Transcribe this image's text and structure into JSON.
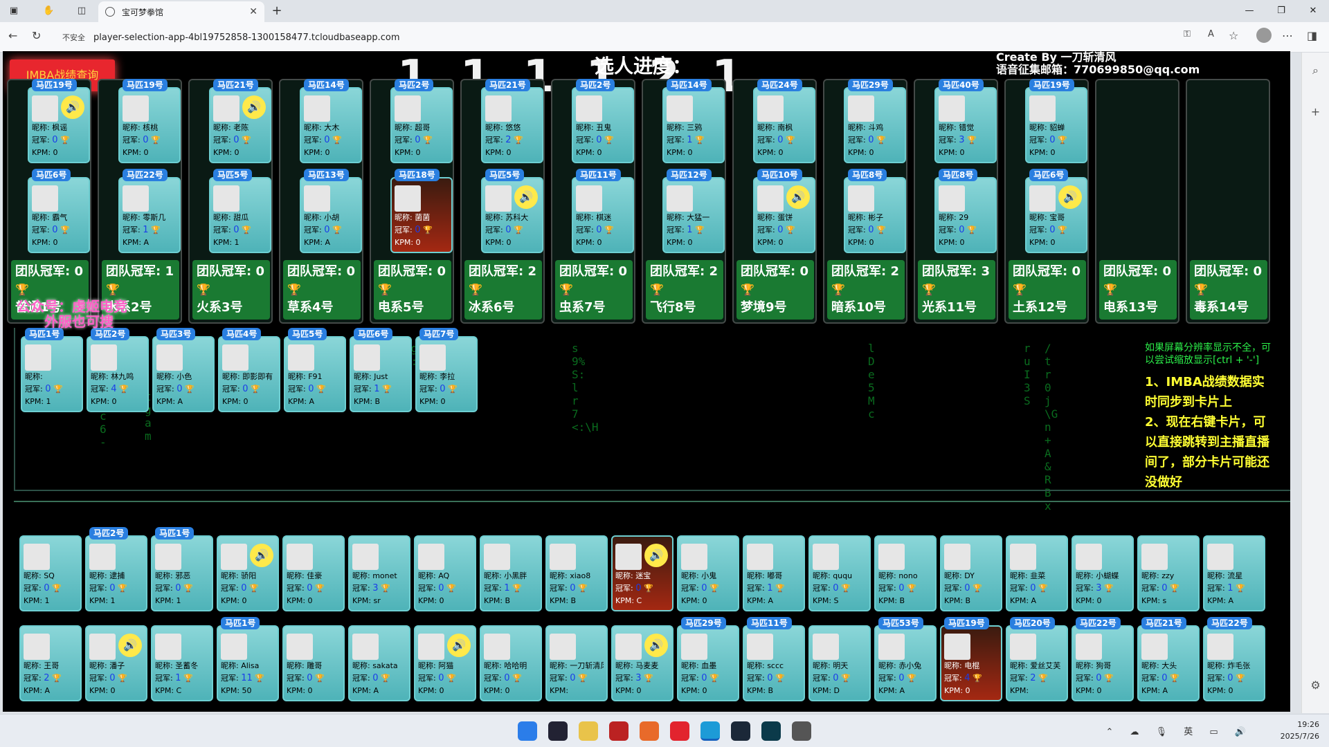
{
  "browser": {
    "tab_title": "宝可梦拳馆",
    "security_label": "不安全",
    "url": "player-selection-app-4bl19752858-1300158477.tcloudbaseapp.com"
  },
  "page": {
    "imba_button": "IMBA战绩查询",
    "progress_label": "选人进度：",
    "progress_digits": "1 1 1 1 2 1",
    "credit_line1": "Create By 一刀斩清风",
    "credit_line2": "语音征集邮箱：770699850@qq.com",
    "instructions_small": "如果屏幕分辨率显示不全，可以尝试缩放显示[ctrl + '-']",
    "instruction_1": "1、IMBA战绩数据实时同步到卡片上",
    "instruction_2": "2、现在右键卡片，可以直接跳转到主播直播间了，部分卡片可能还没做好",
    "watermark_1": "公众号：虔姬电竞",
    "watermark_2": "外服也可搜"
  },
  "teams": [
    {
      "label": "团队冠军: 0",
      "name": "普通1号",
      "cards": [
        {
          "tag": "马匹19号",
          "nick": "枫谣",
          "champ": "0",
          "kpm": "0",
          "speaker": true
        },
        {
          "tag": "马匹6号",
          "nick": "霸气",
          "champ": "0",
          "kpm": "0"
        }
      ]
    },
    {
      "label": "团队冠军: 1",
      "name": "水系2号",
      "cards": [
        {
          "tag": "马匹19号",
          "nick": "核桃",
          "champ": "0",
          "kpm": "0"
        },
        {
          "tag": "马匹22号",
          "nick": "零斯几",
          "champ": "1",
          "kpm": "A"
        }
      ]
    },
    {
      "label": "团队冠军: 0",
      "name": "火系3号",
      "cards": [
        {
          "tag": "马匹21号",
          "nick": "老陈",
          "champ": "0",
          "kpm": "0",
          "speaker": true
        },
        {
          "tag": "马匹5号",
          "nick": "甜瓜",
          "champ": "0",
          "kpm": "1"
        }
      ]
    },
    {
      "label": "团队冠军: 0",
      "name": "草系4号",
      "cards": [
        {
          "tag": "马匹14号",
          "nick": "大木",
          "champ": "0",
          "kpm": "0"
        },
        {
          "tag": "马匹13号",
          "nick": "小胡",
          "champ": "0",
          "kpm": "A"
        }
      ]
    },
    {
      "label": "团队冠军: 0",
      "name": "电系5号",
      "cards": [
        {
          "tag": "马匹2号",
          "nick": "超哥",
          "champ": "0",
          "kpm": "0"
        },
        {
          "tag": "马匹18号",
          "nick": "菌菌",
          "champ": "0",
          "kpm": "0",
          "special": true
        }
      ]
    },
    {
      "label": "团队冠军: 2",
      "name": "冰系6号",
      "cards": [
        {
          "tag": "马匹21号",
          "nick": "悠悠",
          "champ": "2",
          "kpm": "0"
        },
        {
          "tag": "马匹5号",
          "nick": "苏科大",
          "champ": "0",
          "kpm": "0",
          "speaker": true
        }
      ]
    },
    {
      "label": "团队冠军: 0",
      "name": "虫系7号",
      "cards": [
        {
          "tag": "马匹2号",
          "nick": "丑鬼",
          "champ": "0",
          "kpm": "0"
        },
        {
          "tag": "马匹11号",
          "nick": "棋迷",
          "champ": "0",
          "kpm": "0"
        }
      ]
    },
    {
      "label": "团队冠军: 2",
      "name": "飞行8号",
      "cards": [
        {
          "tag": "马匹14号",
          "nick": "三鸦",
          "champ": "1",
          "kpm": "0"
        },
        {
          "tag": "马匹12号",
          "nick": "大猛一",
          "champ": "1",
          "kpm": "0"
        }
      ]
    },
    {
      "label": "团队冠军: 0",
      "name": "梦境9号",
      "cards": [
        {
          "tag": "马匹24号",
          "nick": "南枫",
          "champ": "0",
          "kpm": "0"
        },
        {
          "tag": "马匹10号",
          "nick": "蛋饼",
          "champ": "0",
          "kpm": "0",
          "speaker": true
        }
      ]
    },
    {
      "label": "团队冠军: 2",
      "name": "暗系10号",
      "cards": [
        {
          "tag": "马匹29号",
          "nick": "斗鸡",
          "champ": "0",
          "kpm": "0"
        },
        {
          "tag": "马匹8号",
          "nick": "彬子",
          "champ": "0",
          "kpm": "0"
        }
      ]
    },
    {
      "label": "团队冠军: 3",
      "name": "光系11号",
      "cards": [
        {
          "tag": "马匹40号",
          "nick": "错觉",
          "champ": "3",
          "kpm": "0"
        },
        {
          "tag": "马匹8号",
          "nick": "29",
          "champ": "0",
          "kpm": "0"
        }
      ]
    },
    {
      "label": "团队冠军: 0",
      "name": "土系12号",
      "cards": [
        {
          "tag": "马匹19号",
          "nick": "貂蝉",
          "champ": "0",
          "kpm": "0"
        },
        {
          "tag": "马匹6号",
          "nick": "宝哥",
          "champ": "0",
          "kpm": "0",
          "speaker": true
        }
      ]
    },
    {
      "label": "团队冠军: 0",
      "name": "电系13号",
      "cards": []
    },
    {
      "label": "团队冠军: 0",
      "name": "毒系14号",
      "cards": []
    }
  ],
  "pool": [
    {
      "tag": "马匹1号",
      "nick": "",
      "champ": "0",
      "kpm": "1"
    },
    {
      "tag": "马匹2号",
      "nick": "林九鸣",
      "champ": "4",
      "kpm": "0"
    },
    {
      "tag": "马匹3号",
      "nick": "小色",
      "champ": "0",
      "kpm": "A"
    },
    {
      "tag": "马匹4号",
      "nick": "即影即有",
      "champ": "0",
      "kpm": "0"
    },
    {
      "tag": "马匹5号",
      "nick": "F91",
      "champ": "0",
      "kpm": "A"
    },
    {
      "tag": "马匹6号",
      "nick": "Just",
      "champ": "1",
      "kpm": "B"
    },
    {
      "tag": "马匹7号",
      "nick": "李拉",
      "champ": "0",
      "kpm": "0"
    }
  ],
  "row3": [
    {
      "tag": "",
      "nick": "SQ",
      "champ": "0",
      "kpm": "1"
    },
    {
      "tag": "马匹2号",
      "nick": "逮捕",
      "champ": "0",
      "kpm": "1"
    },
    {
      "tag": "马匹1号",
      "nick": "邪恶",
      "champ": "0",
      "kpm": "1"
    },
    {
      "tag": "",
      "nick": "骄阳",
      "champ": "0",
      "kpm": "0",
      "speaker": true
    },
    {
      "tag": "",
      "nick": "佳豪",
      "champ": "0",
      "kpm": "0"
    },
    {
      "tag": "",
      "nick": "monet",
      "champ": "3",
      "kpm": "sr"
    },
    {
      "tag": "",
      "nick": "AQ",
      "champ": "0",
      "kpm": "0"
    },
    {
      "tag": "",
      "nick": "小黑胖",
      "champ": "1",
      "kpm": "B"
    },
    {
      "tag": "",
      "nick": "xiao8",
      "champ": "0",
      "kpm": "B"
    },
    {
      "tag": "",
      "nick": "迷宝",
      "champ": "0",
      "kpm": "C",
      "special": true,
      "speaker": true
    },
    {
      "tag": "",
      "nick": "小鬼",
      "champ": "0",
      "kpm": "0"
    },
    {
      "tag": "",
      "nick": "嘟哥",
      "champ": "1",
      "kpm": "A"
    },
    {
      "tag": "",
      "nick": "ququ",
      "champ": "0",
      "kpm": "S"
    },
    {
      "tag": "",
      "nick": "nono",
      "champ": "0",
      "kpm": "B"
    },
    {
      "tag": "",
      "nick": "DY",
      "champ": "0",
      "kpm": "B"
    },
    {
      "tag": "",
      "nick": "韭菜",
      "champ": "0",
      "kpm": "A"
    },
    {
      "tag": "",
      "nick": "小蝴蝶",
      "champ": "3",
      "kpm": "0"
    },
    {
      "tag": "",
      "nick": "zzy",
      "champ": "0",
      "kpm": "s"
    },
    {
      "tag": "",
      "nick": "流星",
      "champ": "1",
      "kpm": "A"
    }
  ],
  "row4": [
    {
      "tag": "",
      "nick": "王哥",
      "champ": "2",
      "kpm": "A"
    },
    {
      "tag": "",
      "nick": "潘子",
      "champ": "0",
      "kpm": "0",
      "speaker": true
    },
    {
      "tag": "",
      "nick": "圣蓄冬",
      "champ": "1",
      "kpm": "C"
    },
    {
      "tag": "马匹1号",
      "nick": "Alisa",
      "champ": "11",
      "kpm": "50"
    },
    {
      "tag": "",
      "nick": "雕哥",
      "champ": "0",
      "kpm": "0"
    },
    {
      "tag": "",
      "nick": "sakata",
      "champ": "0",
      "kpm": "A"
    },
    {
      "tag": "",
      "nick": "阿猫",
      "champ": "0",
      "kpm": "0",
      "speaker": true
    },
    {
      "tag": "",
      "nick": "哈哈明",
      "champ": "0",
      "kpm": "0"
    },
    {
      "tag": "",
      "nick": "一刀斩清风",
      "champ": "0",
      "kpm": ""
    },
    {
      "tag": "",
      "nick": "马麦麦",
      "champ": "3",
      "kpm": "0",
      "speaker": true
    },
    {
      "tag": "马匹29号",
      "nick": "血墨",
      "champ": "0",
      "kpm": "0"
    },
    {
      "tag": "马匹11号",
      "nick": "sccc",
      "champ": "0",
      "kpm": "B"
    },
    {
      "tag": "",
      "nick": "明天",
      "champ": "0",
      "kpm": "D"
    },
    {
      "tag": "马匹53号",
      "nick": "赤小兔",
      "champ": "0",
      "kpm": "A"
    },
    {
      "tag": "马匹19号",
      "nick": "电棍",
      "champ": "4",
      "kpm": "0",
      "special": true
    },
    {
      "tag": "马匹20号",
      "nick": "爱丝艾芙",
      "champ": "2",
      "kpm": ""
    },
    {
      "tag": "马匹22号",
      "nick": "狗哥",
      "champ": "0",
      "kpm": "0"
    },
    {
      "tag": "马匹21号",
      "nick": "大头",
      "champ": "0",
      "kpm": "A"
    },
    {
      "tag": "马匹22号",
      "nick": "炸毛张",
      "champ": "0",
      "kpm": "0"
    }
  ],
  "labels": {
    "nick": "昵称: ",
    "champ": "冠军: ",
    "kpm": "KPM: "
  },
  "taskbar": {
    "time": "19:26",
    "date": "2025/7/26",
    "ime": "英"
  }
}
